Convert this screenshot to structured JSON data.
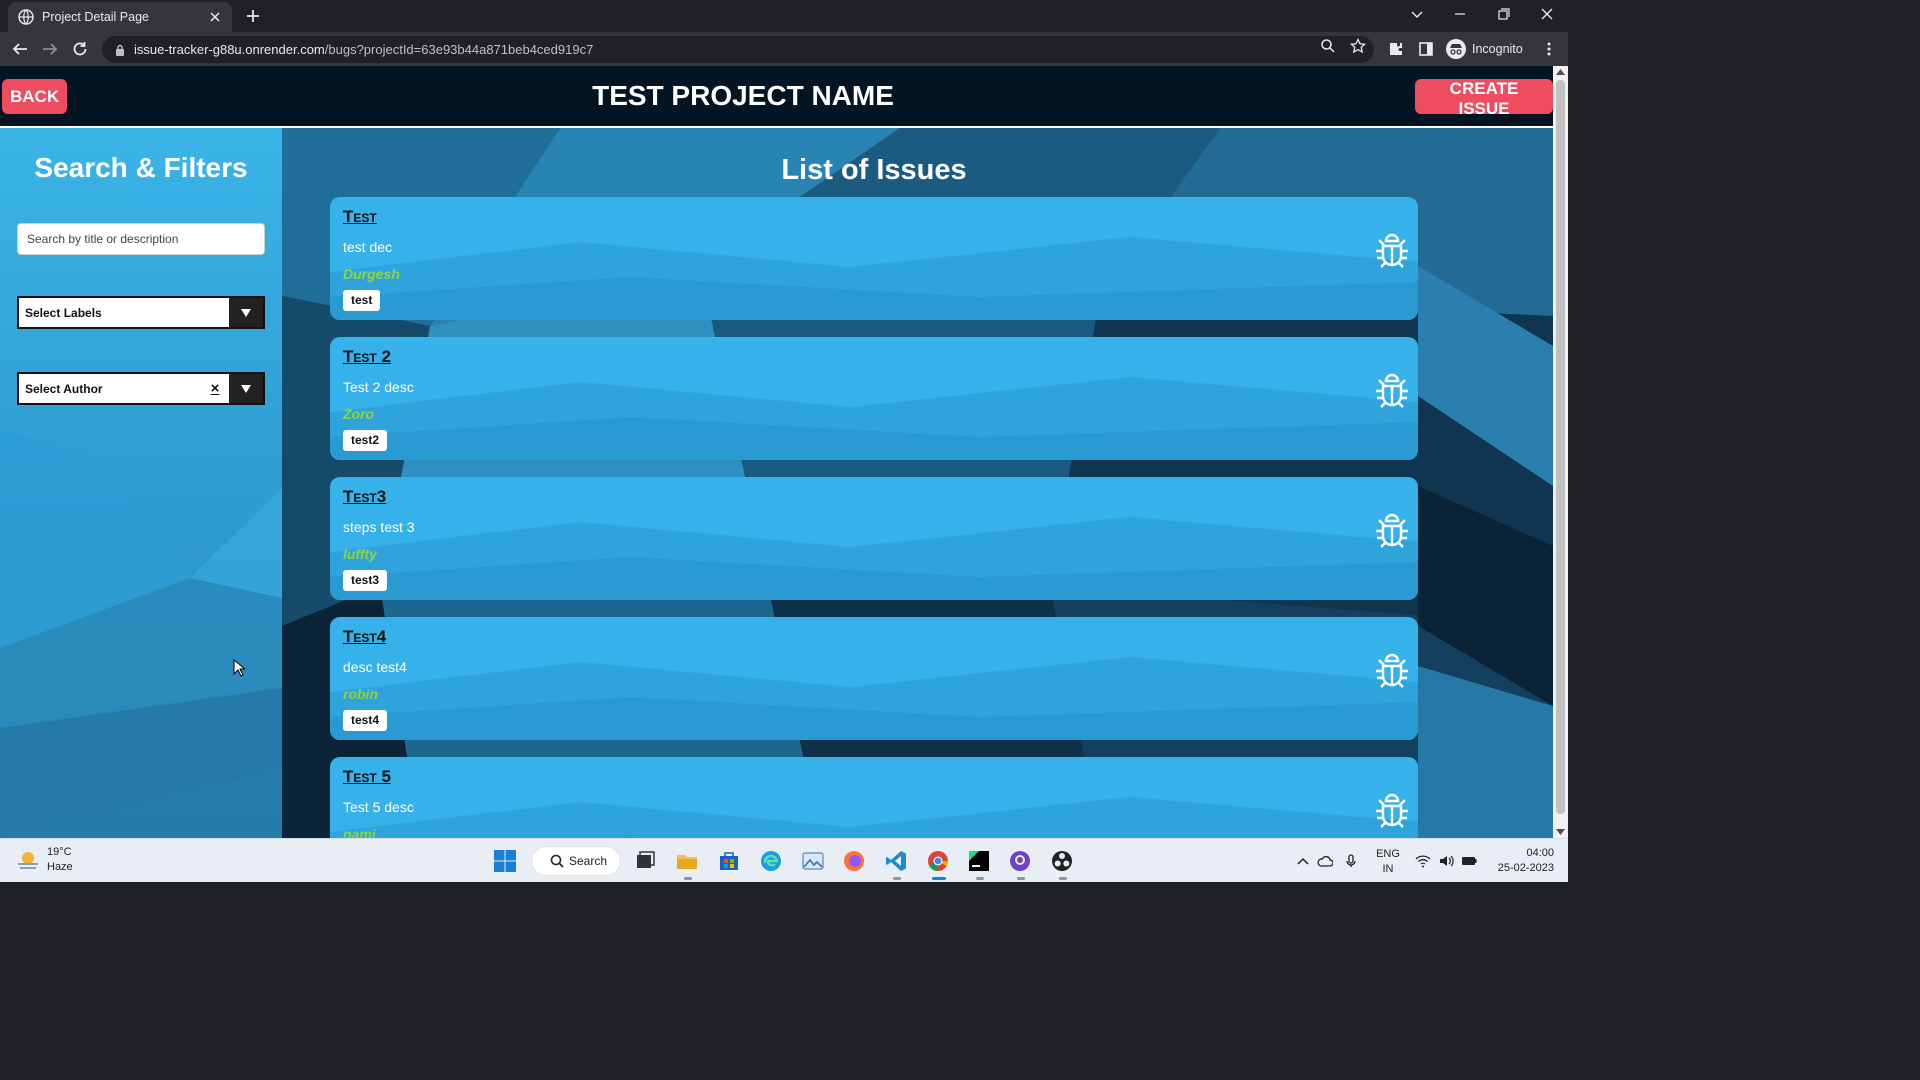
{
  "browser": {
    "tab_title": "Project Detail Page",
    "url_host": "issue-tracker-g88u.onrender.com",
    "url_path": "/bugs?projectId=63e93b44a871beb4ced919c7",
    "profile_label": "Incognito"
  },
  "header": {
    "back_label": "BACK",
    "project_title": "TEST PROJECT NAME",
    "create_label": "CREATE ISSUE"
  },
  "sidebar": {
    "title": "Search & Filters",
    "search_placeholder": "Search by title or description",
    "labels_select": "Select Labels",
    "author_select": "Select Author",
    "clear_symbol": "×"
  },
  "main": {
    "list_title": "List of Issues",
    "issues": [
      {
        "title": "Test",
        "description": "test dec",
        "author": "Durgesh",
        "label": "test"
      },
      {
        "title": "Test 2",
        "description": "Test 2 desc",
        "author": "Zoro",
        "label": "test2"
      },
      {
        "title": "Test3",
        "description": "steps test 3",
        "author": "luffty",
        "label": "test3"
      },
      {
        "title": "Test4",
        "description": "desc test4",
        "author": "robin",
        "label": "test4"
      },
      {
        "title": "Test 5",
        "description": "Test 5 desc",
        "author": "nami",
        "label": ""
      }
    ]
  },
  "taskbar": {
    "temperature": "19°C",
    "weather": "Haze",
    "search_label": "Search",
    "lang_primary": "ENG",
    "lang_region": "IN",
    "time": "04:00",
    "date": "25-02-2023"
  },
  "colors": {
    "accent_red": "#ee4c5f",
    "card_blue": "#37b1ea",
    "header_dark": "#031523",
    "author_green": "#8fd43a"
  }
}
